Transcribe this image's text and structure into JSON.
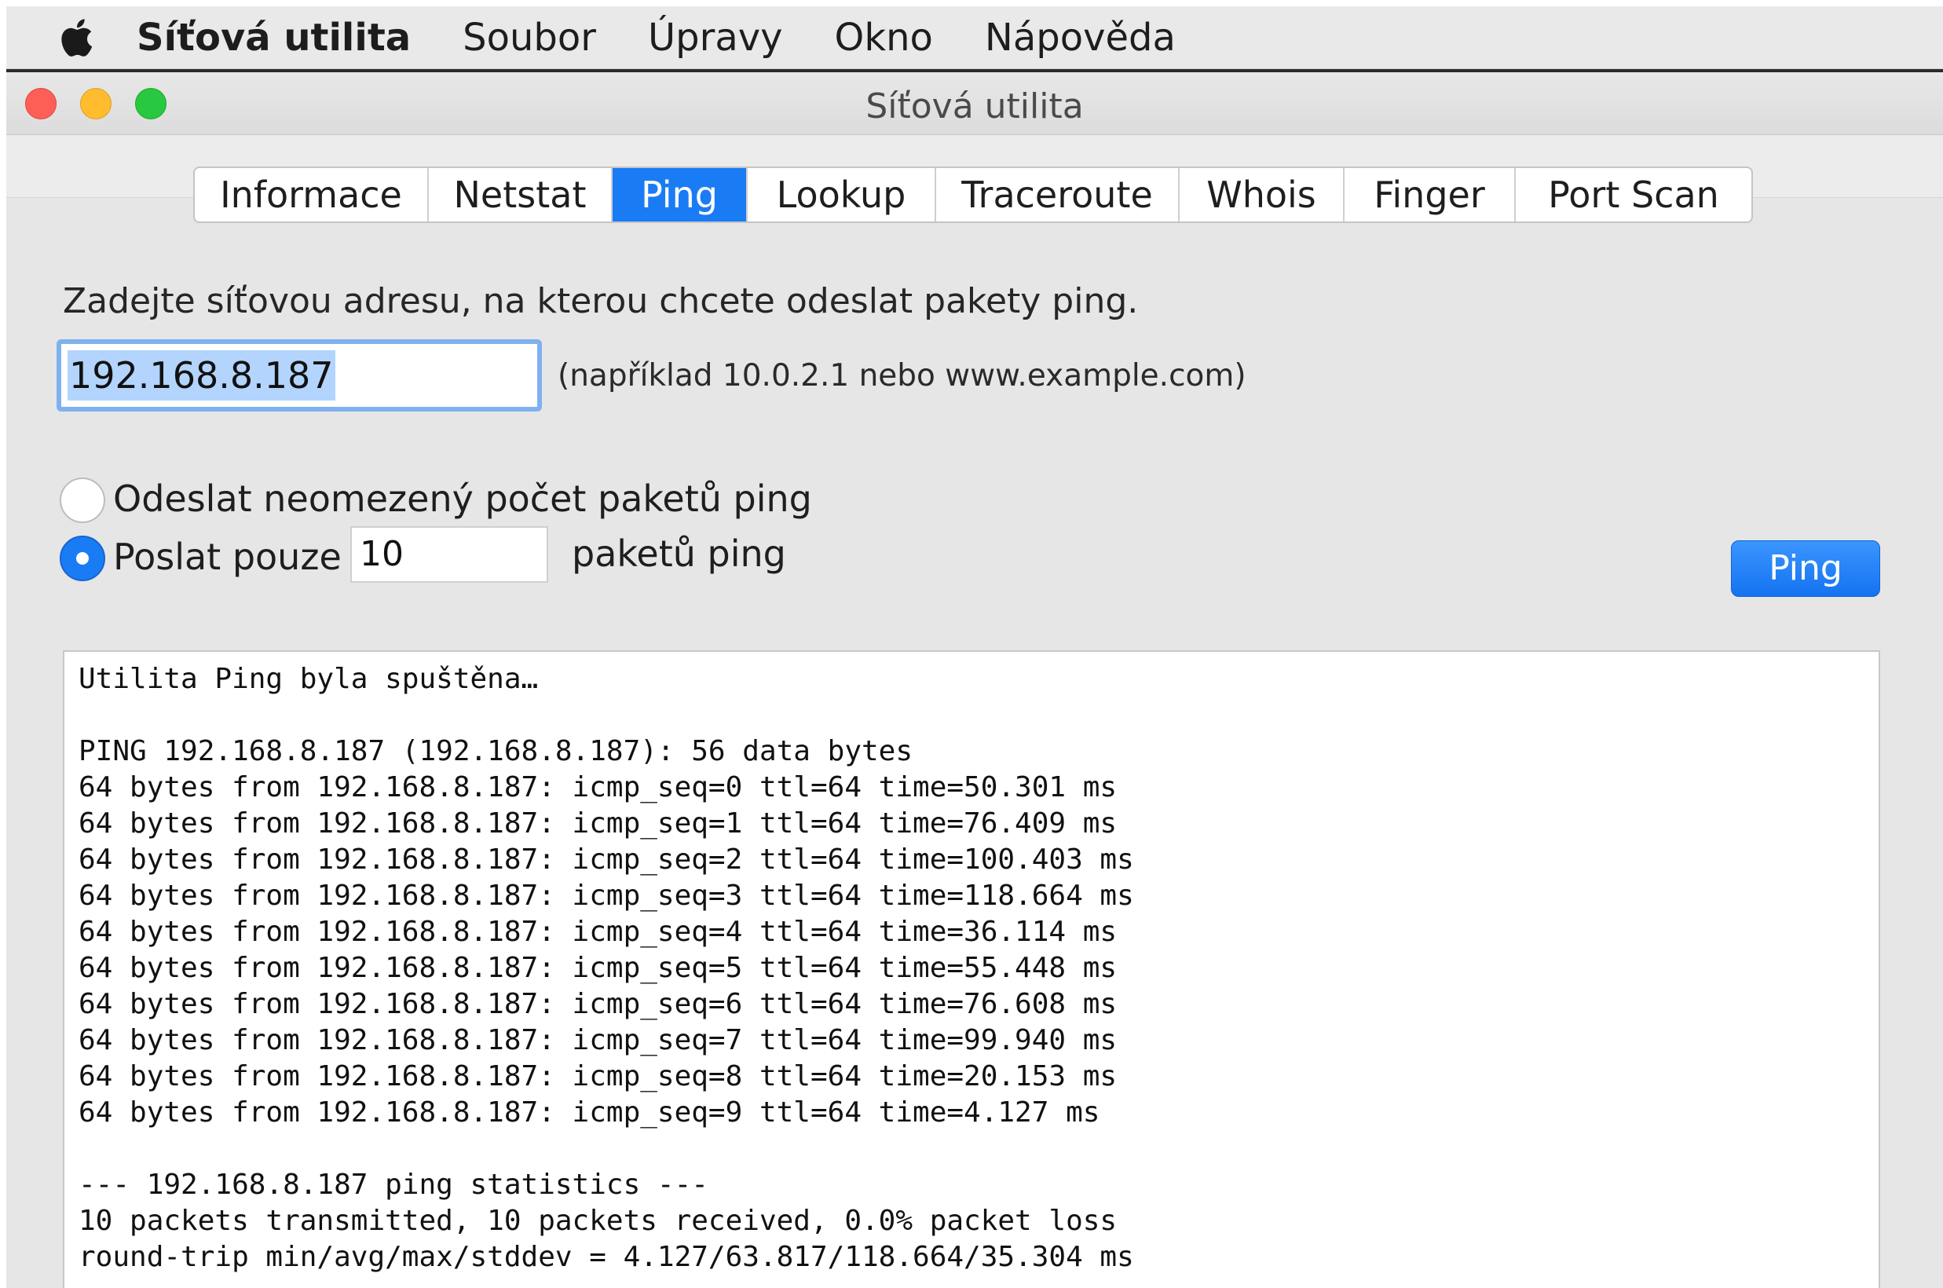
{
  "menubar": {
    "apple_icon": "apple-logo-icon",
    "items": [
      "Síťová utilita",
      "Soubor",
      "Úpravy",
      "Okno",
      "Nápověda"
    ]
  },
  "window": {
    "title": "Síťová utilita",
    "traffic_lights": {
      "close": "#fd5f57",
      "minimize": "#febc2e",
      "zoom": "#28c840"
    }
  },
  "tabs": [
    {
      "label": "Informace",
      "active": false
    },
    {
      "label": "Netstat",
      "active": false
    },
    {
      "label": "Ping",
      "active": true
    },
    {
      "label": "Lookup",
      "active": false
    },
    {
      "label": "Traceroute",
      "active": false
    },
    {
      "label": "Whois",
      "active": false
    },
    {
      "label": "Finger",
      "active": false
    },
    {
      "label": "Port Scan",
      "active": false
    }
  ],
  "ping": {
    "prompt": "Zadejte síťovou adresu, na kterou chcete odeslat pakety ping.",
    "address_value": "192.168.8.187",
    "address_hint": "(například 10.0.2.1 nebo www.example.com)",
    "option_unlimited": "Odeslat neomezený počet paketů ping",
    "option_limited_prefix": "Poslat pouze",
    "count_value": "10",
    "option_limited_suffix": "paketů ping",
    "selected_option": "limited",
    "button_label": "Ping"
  },
  "output": {
    "lines": [
      "Utilita Ping byla spuštěna…",
      "",
      "PING 192.168.8.187 (192.168.8.187): 56 data bytes",
      "64 bytes from 192.168.8.187: icmp_seq=0 ttl=64 time=50.301 ms",
      "64 bytes from 192.168.8.187: icmp_seq=1 ttl=64 time=76.409 ms",
      "64 bytes from 192.168.8.187: icmp_seq=2 ttl=64 time=100.403 ms",
      "64 bytes from 192.168.8.187: icmp_seq=3 ttl=64 time=118.664 ms",
      "64 bytes from 192.168.8.187: icmp_seq=4 ttl=64 time=36.114 ms",
      "64 bytes from 192.168.8.187: icmp_seq=5 ttl=64 time=55.448 ms",
      "64 bytes from 192.168.8.187: icmp_seq=6 ttl=64 time=76.608 ms",
      "64 bytes from 192.168.8.187: icmp_seq=7 ttl=64 time=99.940 ms",
      "64 bytes from 192.168.8.187: icmp_seq=8 ttl=64 time=20.153 ms",
      "64 bytes from 192.168.8.187: icmp_seq=9 ttl=64 time=4.127 ms",
      "",
      "--- 192.168.8.187 ping statistics ---",
      "10 packets transmitted, 10 packets received, 0.0% packet loss",
      "round-trip min/avg/max/stddev = 4.127/63.817/118.664/35.304 ms"
    ]
  },
  "colors": {
    "accent": "#1a7cf5",
    "selection": "#b3d4fc",
    "focus_ring": "#7fb1f0"
  }
}
